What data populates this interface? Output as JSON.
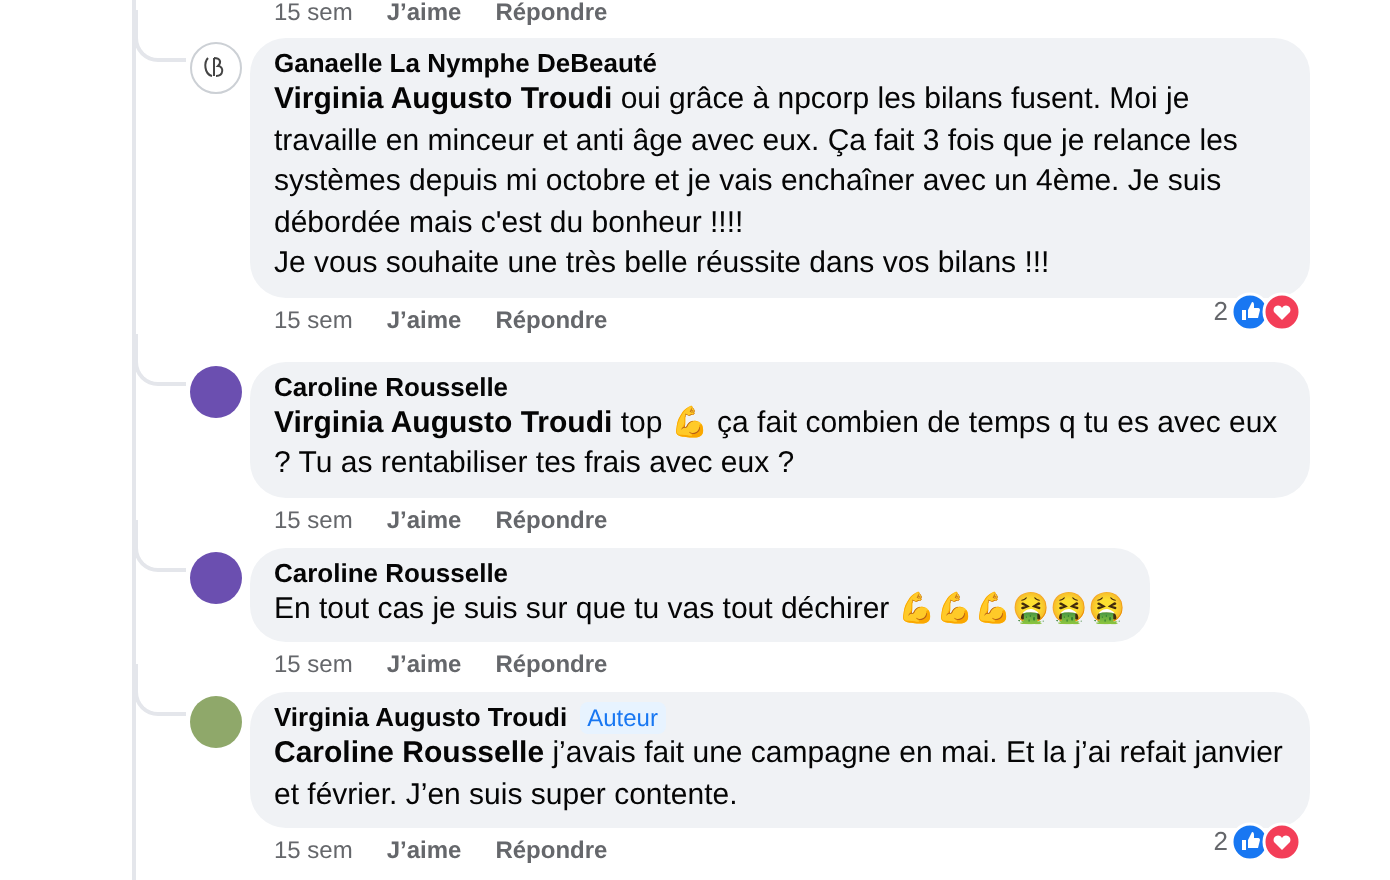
{
  "previous_actions": {
    "time": "15 sem",
    "like": "J’aime",
    "reply": "Répondre"
  },
  "comments": [
    {
      "author": "Ganaelle La Nymphe DeBeauté",
      "avatar": {
        "kind": "logo"
      },
      "paragraphs": [
        "**Virginia Augusto Troudi** oui grâce à npcorp les bilans fusent. Moi je travaille en minceur et anti âge avec eux. Ça fait 3 fois que je relance les systèmes depuis mi octobre et je vais enchaîner avec un 4ème. Je suis débordée mais c'est du bonheur !!!!",
        "Je vous souhaite une très belle réussite dans vos bilans !!!"
      ],
      "time": "15 sem",
      "like": "J’aime",
      "reply": "Répondre",
      "reaction_count": "2"
    },
    {
      "author": "Caroline Rousselle",
      "avatar": {
        "kind": "photo"
      },
      "paragraphs": [
        "**Virginia Augusto Troudi** top 💪 ça fait combien de temps q tu es avec eux ? Tu as rentabiliser tes frais avec eux ?"
      ],
      "time": "15 sem",
      "like": "J’aime",
      "reply": "Répondre"
    },
    {
      "author": "Caroline Rousselle",
      "avatar": {
        "kind": "photo"
      },
      "paragraphs": [
        "En tout cas je suis sur que tu vas tout déchirer 💪💪💪🤮🤮🤮"
      ],
      "time": "15 sem",
      "like": "J’aime",
      "reply": "Répondre"
    },
    {
      "author": "Virginia Augusto Troudi",
      "badge": "Auteur",
      "avatar": {
        "kind": "photo"
      },
      "paragraphs": [
        "**Caroline Rousselle** j’avais fait une campagne en mai. Et la j’ai refait janvier et février. J’en suis super contente."
      ],
      "time": "15 sem",
      "like": "J’aime",
      "reply": "Répondre",
      "reaction_count": "2"
    }
  ]
}
